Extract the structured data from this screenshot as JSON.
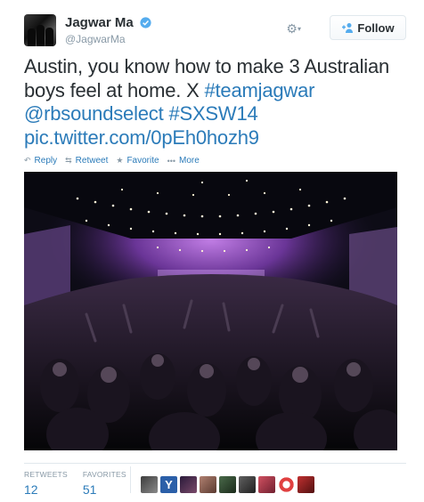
{
  "header": {
    "name": "Jagwar Ma",
    "screen_name": "@JagwarMa",
    "follow_label": "Follow",
    "verified_color": "#55acee"
  },
  "tweet": {
    "text_plain": "Austin, you know how to make 3 Australian boys feel at home. X ",
    "hashtag1": "#teamjagwar",
    "mention": "@rbsoundselect",
    "hashtag2": "#SXSW14",
    "link": "pic.twitter.com/0pEh0hozh9"
  },
  "actions": {
    "reply": "Reply",
    "retweet": "Retweet",
    "favorite": "Favorite",
    "more": "More"
  },
  "stats": {
    "retweets_label": "RETWEETS",
    "retweets_value": "12",
    "favorites_label": "FAVORITES",
    "favorites_value": "51"
  },
  "colors": {
    "link": "#2b7bb9",
    "muted": "#8899a6",
    "text": "#292f33",
    "border": "#e1e8ed"
  },
  "icons": [
    "gear-icon",
    "chevron-down-icon",
    "follow-person-icon",
    "verified-badge-icon",
    "reply-icon",
    "retweet-icon",
    "favorite-star-icon",
    "more-dots-icon"
  ]
}
